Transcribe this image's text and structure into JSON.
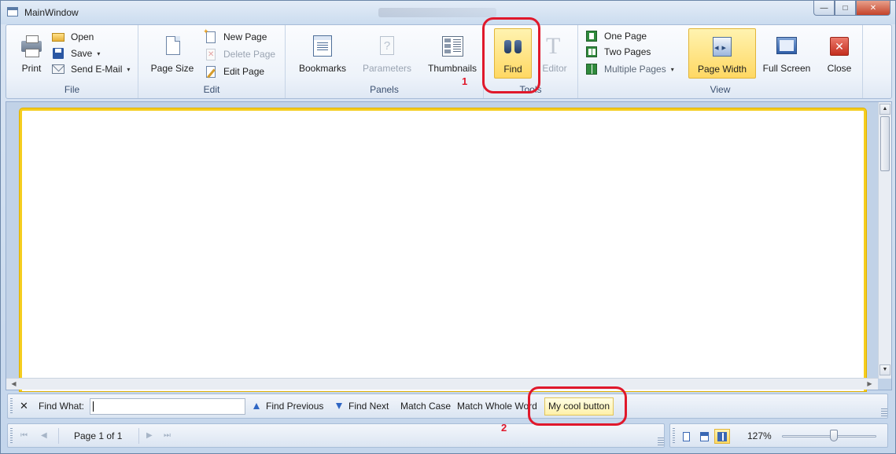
{
  "window": {
    "title": "MainWindow",
    "minimize_glyph": "—",
    "maximize_glyph": "□",
    "close_glyph": "✕"
  },
  "ribbon": {
    "file": {
      "label": "File",
      "print": "Print",
      "open": "Open",
      "save": "Save",
      "send_email": "Send E-Mail"
    },
    "edit": {
      "label": "Edit",
      "page_size": "Page Size",
      "new_page": "New Page",
      "delete_page": "Delete Page",
      "edit_page": "Edit Page"
    },
    "panels": {
      "label": "Panels",
      "bookmarks": "Bookmarks",
      "parameters": "Parameters",
      "thumbnails": "Thumbnails"
    },
    "tools": {
      "label": "Tools",
      "find": "Find",
      "editor": "Editor",
      "editor_glyph": "T"
    },
    "view": {
      "label": "View",
      "one_page": "One Page",
      "two_pages": "Two Pages",
      "multiple_pages": "Multiple Pages",
      "page_width": "Page Width",
      "full_screen": "Full Screen",
      "close": "Close",
      "close_glyph": "✕"
    },
    "dropdown_glyph": "▾"
  },
  "find_bar": {
    "close_glyph": "✕",
    "find_what_label": "Find What:",
    "find_what_value": "",
    "find_previous": "Find Previous",
    "find_next": "Find Next",
    "match_case": "Match Case",
    "match_whole_word": "Match Whole Word",
    "custom_button": "My cool button"
  },
  "status_bar": {
    "page_label": "Page 1 of 1",
    "zoom": "127%",
    "zoom_level": 0.55,
    "nav_first_glyph": "⏮",
    "nav_prev_glyph": "◀",
    "nav_next_glyph": "▶",
    "nav_last_glyph": "⏭"
  },
  "scrollbar_glyphs": {
    "up": "▲",
    "down": "▼",
    "left": "◀",
    "right": "▶"
  },
  "annotations": [
    {
      "label": "1",
      "color": "#e0182b"
    },
    {
      "label": "2",
      "color": "#e0182b"
    }
  ],
  "colors": {
    "page_border": "#f5cd1e",
    "active_button": "#ffd863",
    "annotation": "#e0182b"
  }
}
